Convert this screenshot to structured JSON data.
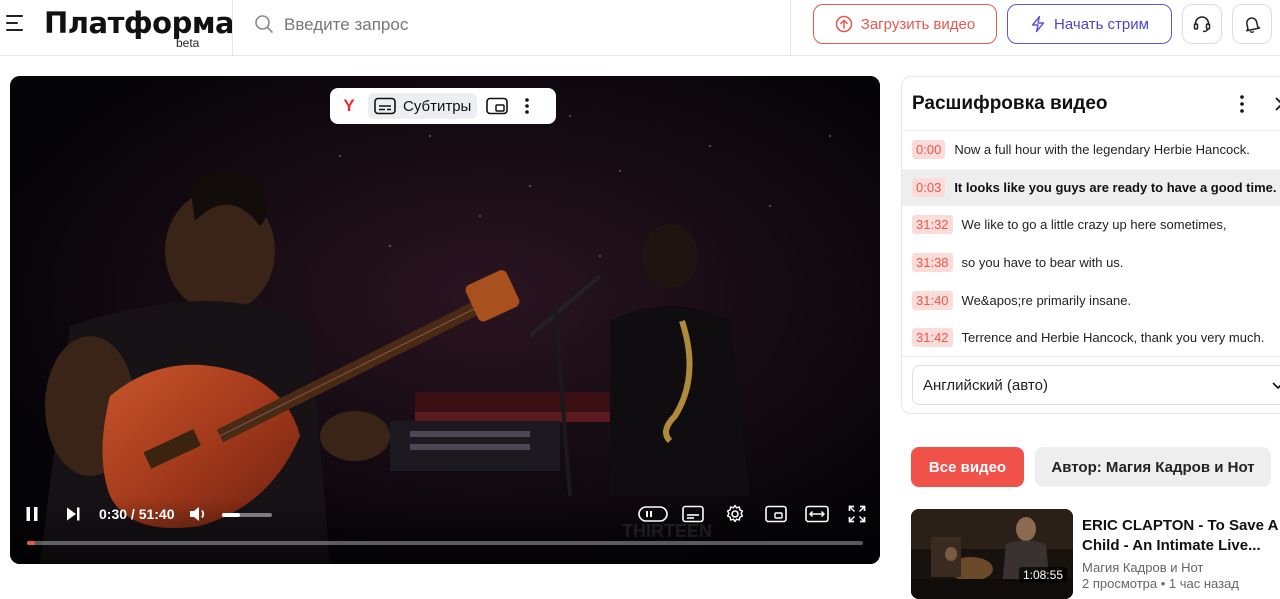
{
  "header": {
    "logo": "Платформа",
    "logo_badge": "beta",
    "search_placeholder": "Введите запрос",
    "upload_label": "Загрузить видео",
    "stream_label": "Начать стрим"
  },
  "player": {
    "subtitles_label": "Субтитры",
    "ya_logo": "Y",
    "time": "0:30 / 51:40",
    "progress": 0.0097,
    "volume": 0.35
  },
  "transcript": {
    "title": "Расшифровка видео",
    "items": [
      {
        "time": "0:00",
        "text": "Now a full hour with the legendary Herbie Hancock.",
        "active": false
      },
      {
        "time": "0:03",
        "text": "It looks like you guys are ready to have a good time.",
        "active": true
      },
      {
        "time": "31:32",
        "text": "We like to go a little crazy up here sometimes,",
        "active": false
      },
      {
        "time": "31:38",
        "text": "so you have to bear with us.",
        "active": false
      },
      {
        "time": "31:40",
        "text": "We&apos;re primarily insane.",
        "active": false
      },
      {
        "time": "31:42",
        "text": "Terrence and Herbie Hancock, thank you very much.",
        "active": false
      }
    ],
    "language": "Английский (авто)"
  },
  "filters": {
    "all_label": "Все видео",
    "author_label": "Автор: Магия Кадров и Нот"
  },
  "recommendation": {
    "title": "ERIC CLAPTON - To Save A Child - An Intimate Live...",
    "author": "Магия Кадров и Нот",
    "meta": "2 просмотра • 1 час назад",
    "duration": "1:08:55"
  },
  "colors": {
    "accent": "#e8584d",
    "stream": "#5b56d6",
    "active_row": "#eeeeee"
  }
}
